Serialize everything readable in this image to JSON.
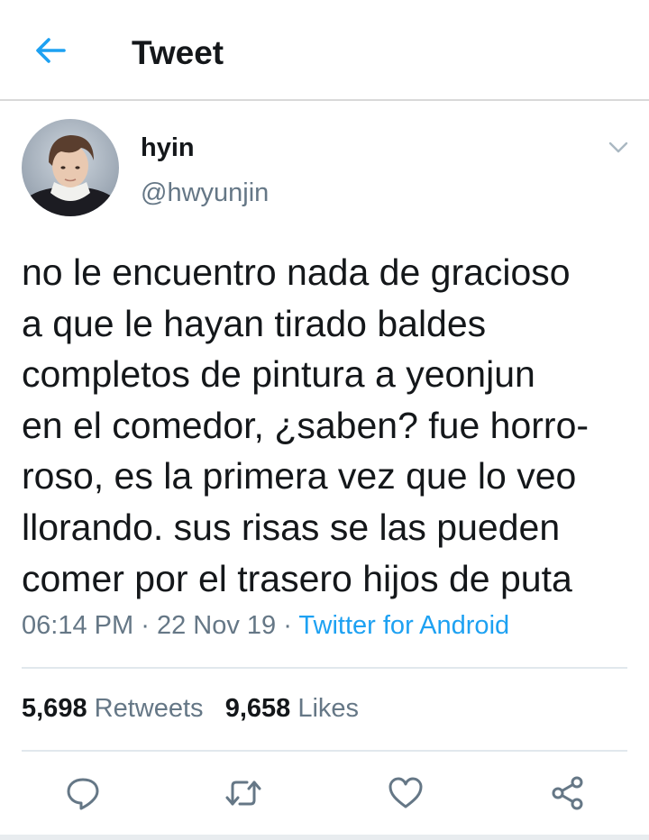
{
  "header": {
    "title": "Tweet",
    "back_icon": "arrow-left-icon"
  },
  "user": {
    "display_name": "hyin",
    "handle": "@hwyunjin"
  },
  "tweet": {
    "lines": [
      "no le encuentro nada de gracioso",
      "a que le hayan tirado baldes",
      "completos de pintura a yeonjun",
      "en el comedor, ¿saben? fue horro-",
      "roso, es la primera vez que lo veo",
      "llorando. sus risas se las pueden",
      "comer por el trasero hijos de puta"
    ],
    "time": "06:14 PM",
    "date": "22 Nov 19",
    "separator": "·",
    "source": "Twitter for Android"
  },
  "stats": {
    "retweets_count": "5,698",
    "retweets_label": "Retweets",
    "likes_count": "9,658",
    "likes_label": "Likes"
  },
  "actions": [
    "reply-icon",
    "retweet-icon",
    "like-icon",
    "share-icon"
  ],
  "colors": {
    "accent": "#1da1f2",
    "text": "#14171a",
    "secondary": "#657786",
    "divider": "#e1e8ed"
  }
}
